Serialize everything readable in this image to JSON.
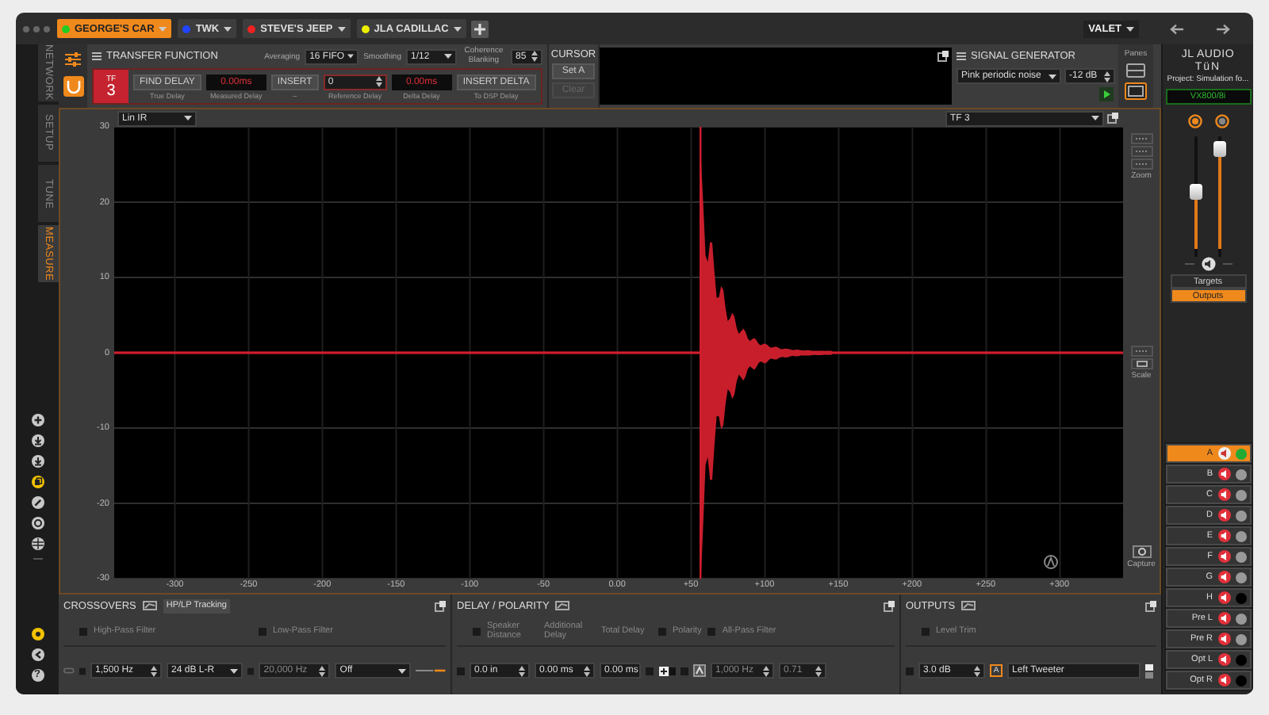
{
  "session_tabs": [
    {
      "label": "GEORGE'S CAR",
      "color": "#22cc22",
      "selected": true
    },
    {
      "label": "TWK",
      "color": "#2244ff",
      "selected": false
    },
    {
      "label": "STEVE'S JEEP",
      "color": "#ee2222",
      "selected": false
    },
    {
      "label": "JLA CADILLAC",
      "color": "#eeee00",
      "selected": false
    }
  ],
  "user_menu": "VALET",
  "nav_tabs": [
    {
      "label": "NETWORK",
      "selected": false
    },
    {
      "label": "SETUP",
      "selected": false
    },
    {
      "label": "TUNE",
      "selected": false
    },
    {
      "label": "MEASURE",
      "selected": true
    }
  ],
  "help": "?",
  "transfer_function": {
    "title": "TRANSFER FUNCTION",
    "averaging_label": "Averaging",
    "averaging": "16 FIFO",
    "smoothing_label": "Smoothing",
    "smoothing": "1/12",
    "coherence_label": "Coherence Blanking",
    "coherence": "85",
    "badge_label": "TF",
    "badge_number": "3",
    "steps": [
      {
        "kind": "button",
        "text": "FIND DELAY",
        "caption": "True Delay"
      },
      {
        "kind": "readout",
        "text": "0.00ms",
        "caption": "Measured Delay"
      },
      {
        "kind": "button",
        "text": "INSERT",
        "caption": "–"
      },
      {
        "kind": "input",
        "text": "0",
        "caption": "Reference Delay"
      },
      {
        "kind": "readout",
        "text": "0.00ms",
        "caption": "Delta Delay"
      },
      {
        "kind": "button",
        "text": "INSERT DELTA",
        "caption": "To DSP Delay"
      }
    ]
  },
  "cursor": {
    "title": "CURSOR",
    "buttons": [
      {
        "label": "Set A",
        "disabled": false
      },
      {
        "label": "Clear",
        "disabled": true
      }
    ]
  },
  "signal_generator": {
    "title": "SIGNAL GENERATOR",
    "signal": "Pink periodic noise",
    "level": "-12 dB"
  },
  "panes_label": "Panes",
  "chart": {
    "view": "Lin IR",
    "trace": "TF 3",
    "y_ticks": [
      "30",
      "20",
      "10",
      "0",
      "-10",
      "-20",
      "-30"
    ],
    "x_ticks": [
      "-300",
      "-250",
      "-200",
      "-150",
      "-100",
      "-50",
      "0.00",
      "+50",
      "+100",
      "+150",
      "+200",
      "+250",
      "+300"
    ],
    "zoom_label": "Zoom",
    "scale_label": "Scale",
    "capture_label": "Capture"
  },
  "crossovers": {
    "title": "CROSSOVERS",
    "tracking": "HP/LP Tracking",
    "high_pass_label": "High-Pass Filter",
    "low_pass_label": "Low-Pass Filter",
    "checks": [
      false,
      false,
      false,
      false
    ],
    "hp_freq": "1,500 Hz",
    "hp_slope": "24 dB L-R",
    "lp_freq": "20,000 Hz",
    "lp_slope": "Off"
  },
  "delay_polarity": {
    "title": "DELAY / POLARITY",
    "distance_label": "Speaker Distance",
    "additional_label": "Additional Delay",
    "total_label": "Total Delay",
    "polarity_label": "Polarity",
    "all_pass_label": "All-Pass Filter",
    "checks": [
      false,
      false,
      false,
      false,
      false,
      false
    ],
    "distance": "0.0 in",
    "additional": "0.00 ms",
    "total": "0.00 ms",
    "ap_freq": "1,000 Hz",
    "ap_q": "0.71"
  },
  "outputs": {
    "title": "OUTPUTS",
    "level_trim_label": "Level Trim",
    "checks": [
      false,
      false
    ],
    "trim": "3.0 dB",
    "channel_badge": "A",
    "output_name": "Left Tweeter"
  },
  "brand": {
    "line1": "JL AUDIO",
    "line2": "TüN"
  },
  "project": "Project: Simulation fo...",
  "device": "VX800/8i",
  "faders": [
    {
      "level": 0.55
    },
    {
      "level": 0.95
    }
  ],
  "view_buttons": [
    {
      "label": "Targets",
      "selected": false
    },
    {
      "label": "Outputs",
      "selected": true
    }
  ],
  "channels": [
    {
      "name": "A",
      "selected": true,
      "color": "#22aa33"
    },
    {
      "name": "B",
      "selected": false,
      "color": "#999999"
    },
    {
      "name": "C",
      "selected": false,
      "color": "#999999"
    },
    {
      "name": "D",
      "selected": false,
      "color": "#999999"
    },
    {
      "name": "E",
      "selected": false,
      "color": "#999999"
    },
    {
      "name": "F",
      "selected": false,
      "color": "#999999"
    },
    {
      "name": "G",
      "selected": false,
      "color": "#999999"
    },
    {
      "name": "H",
      "selected": false,
      "color": "#000000"
    },
    {
      "name": "Pre L",
      "selected": false,
      "color": "#999999"
    },
    {
      "name": "Pre R",
      "selected": false,
      "color": "#999999"
    },
    {
      "name": "Opt L",
      "selected": false,
      "color": "#000000"
    },
    {
      "name": "Opt R",
      "selected": false,
      "color": "#000000"
    }
  ]
}
